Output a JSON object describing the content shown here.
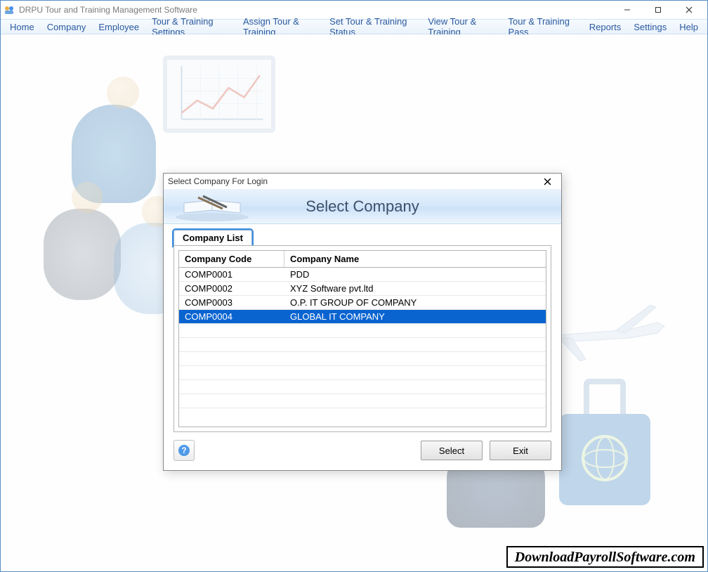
{
  "app": {
    "title": "DRPU Tour and Training Management Software"
  },
  "menu": {
    "items": [
      "Home",
      "Company",
      "Employee",
      "Tour & Training Settings",
      "Assign Tour & Training",
      "Set Tour & Training Status",
      "View Tour & Training",
      "Tour & Training Pass",
      "Reports",
      "Settings",
      "Help"
    ]
  },
  "dialog": {
    "title": "Select Company For Login",
    "header": "Select Company",
    "tab_label": "Company List",
    "columns": {
      "code": "Company Code",
      "name": "Company Name"
    },
    "rows": [
      {
        "code": "COMP0001",
        "name": "PDD"
      },
      {
        "code": "COMP0002",
        "name": "XYZ Software pvt.ltd"
      },
      {
        "code": "COMP0003",
        "name": "O.P. IT GROUP OF COMPANY"
      },
      {
        "code": "COMP0004",
        "name": "GLOBAL IT COMPANY"
      }
    ],
    "selected_index": 3,
    "buttons": {
      "select": "Select",
      "exit": "Exit"
    }
  },
  "watermark": "DownloadPayrollSoftware.com"
}
